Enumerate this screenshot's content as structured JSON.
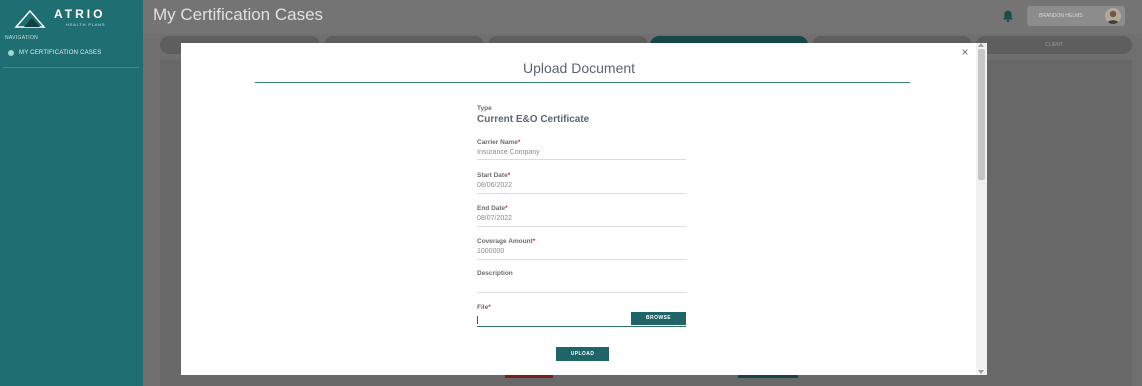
{
  "app": {
    "logo_text": "ATRIO",
    "logo_subtext": "HEALTH PLANS",
    "page_title": "My Certification Cases"
  },
  "sidebar": {
    "heading": "NAVIGATION",
    "items": [
      {
        "label": "MY CERTIFICATION CASES",
        "icon": "dot-icon"
      }
    ]
  },
  "header": {
    "user_name": "BRANDON HELMS",
    "bell_icon": "bell-icon"
  },
  "background": {
    "tabs": [
      "",
      "",
      "",
      "",
      "",
      "CLIENT"
    ]
  },
  "modal": {
    "title": "Upload Document",
    "close_label": "×",
    "type_label": "Type",
    "type_value": "Current E&O Certificate",
    "fields": [
      {
        "label": "Carrier Name",
        "required": "*",
        "value": "Insurance Company"
      },
      {
        "label": "Start Date",
        "required": "*",
        "value": "08/06/2022"
      },
      {
        "label": "End Date",
        "required": "*",
        "value": "08/07/2022"
      },
      {
        "label": "Coverage Amount",
        "required": "*",
        "value": "1000000"
      },
      {
        "label": "Description",
        "required": "",
        "value": ""
      }
    ],
    "file": {
      "label": "File",
      "required": "*",
      "value": ""
    },
    "browse_label": "BROWSE",
    "upload_label": "UPLOAD"
  },
  "colors": {
    "sidebar_teal": "#1f6f72",
    "button_teal": "#1f6467",
    "required_red": "#cc2b2b",
    "overlay_gray": "#6f6f6f"
  }
}
